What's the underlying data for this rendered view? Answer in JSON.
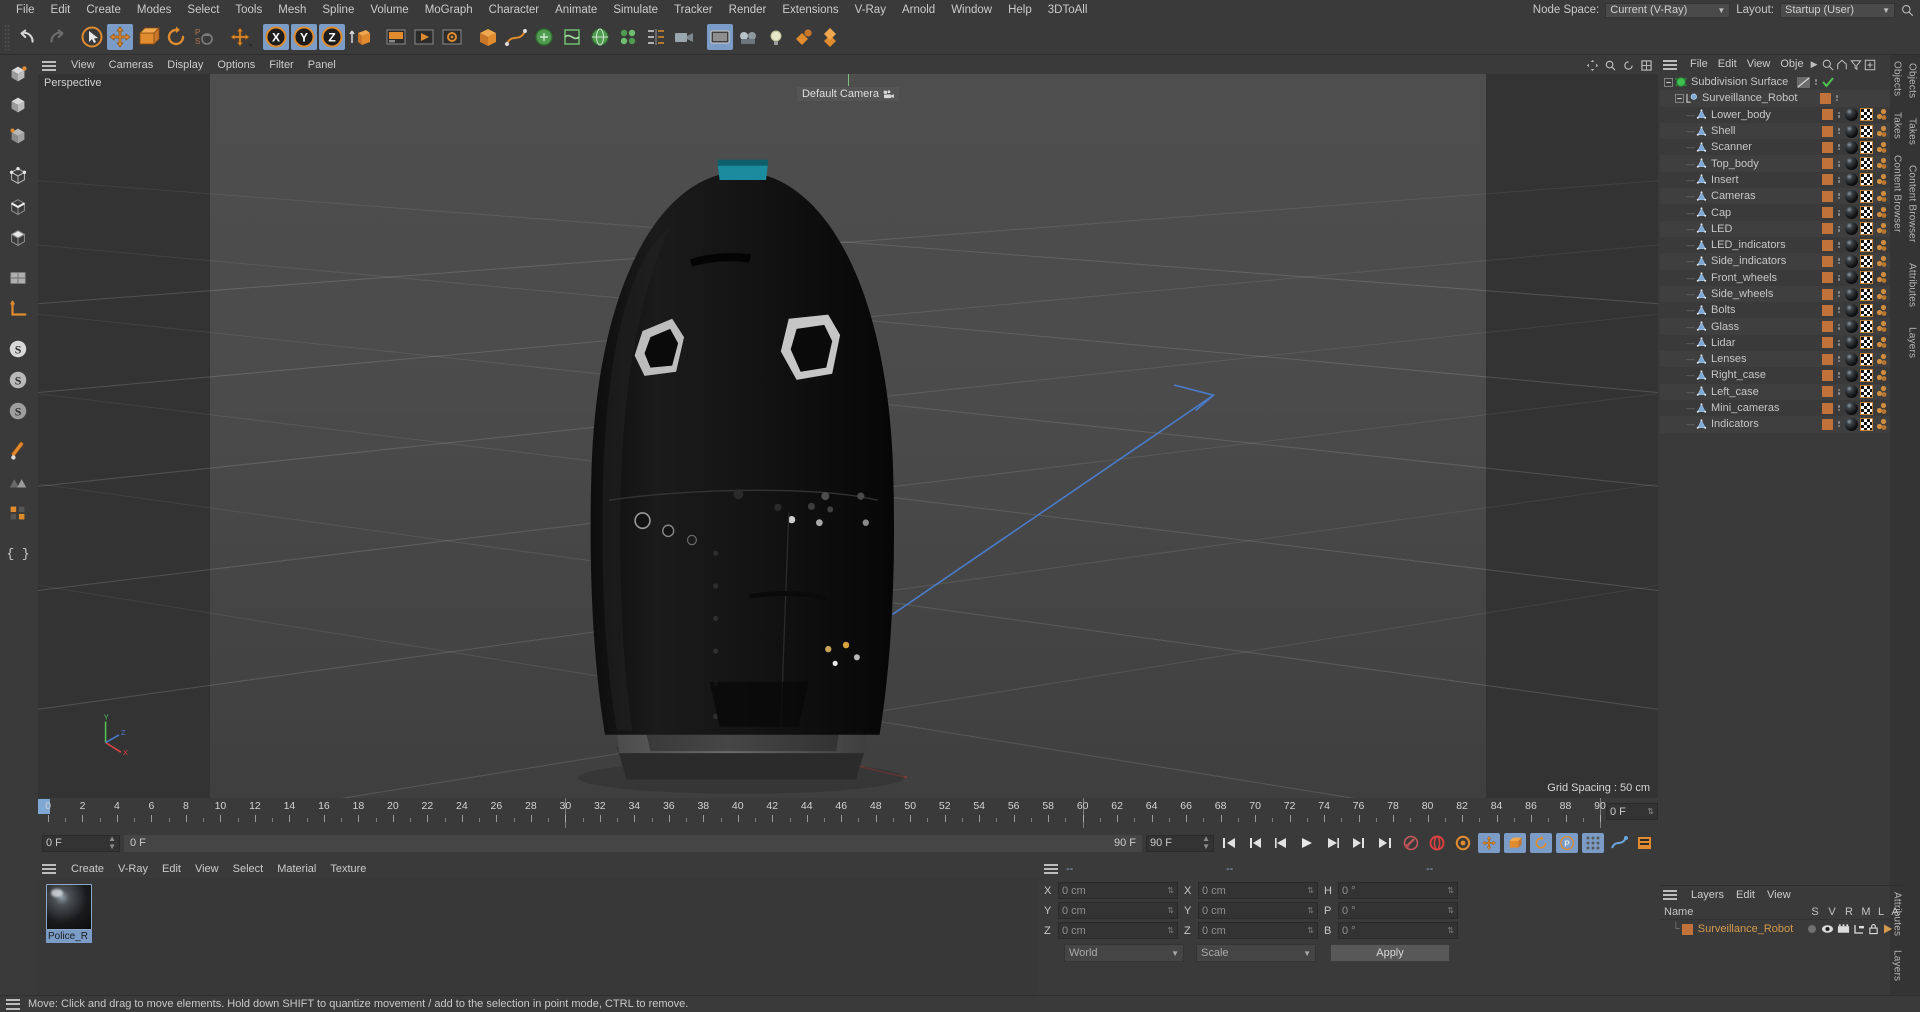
{
  "menubar": {
    "items": [
      "File",
      "Edit",
      "Create",
      "Modes",
      "Select",
      "Tools",
      "Mesh",
      "Spline",
      "Volume",
      "MoGraph",
      "Character",
      "Animate",
      "Simulate",
      "Tracker",
      "Render",
      "Extensions",
      "V-Ray",
      "Arnold",
      "Window",
      "Help",
      "3DToAll"
    ],
    "node_space_label": "Node Space:",
    "node_space_value": "Current (V-Ray)",
    "layout_label": "Layout:",
    "layout_value": "Startup (User)"
  },
  "toolbar": {
    "buttons": [
      {
        "name": "undo",
        "label": "Undo",
        "active": false
      },
      {
        "name": "redo",
        "label": "Redo",
        "active": false
      },
      {
        "name": "live-selection",
        "label": "Live Selection",
        "active": false
      },
      {
        "name": "move",
        "label": "Move",
        "active": true
      },
      {
        "name": "scale",
        "label": "Scale",
        "active": false
      },
      {
        "name": "rotate",
        "label": "Rotate",
        "active": false
      },
      {
        "name": "parametric-switch",
        "label": "Parametric",
        "active": false
      },
      {
        "name": "world-coordinate",
        "label": "World Coordinate System",
        "active": false
      },
      {
        "name": "x-axis-lock",
        "label": "X",
        "active": true
      },
      {
        "name": "y-axis-lock",
        "label": "Y",
        "active": true
      },
      {
        "name": "z-axis-lock",
        "label": "Z",
        "active": true
      },
      {
        "name": "world-object-axis",
        "label": "World/Object",
        "active": false
      },
      {
        "name": "render-view",
        "label": "Render View",
        "active": false
      },
      {
        "name": "render-to-picture-viewer",
        "label": "Render to Picture Viewer",
        "active": false
      },
      {
        "name": "render-settings",
        "label": "Render Settings",
        "active": false
      },
      {
        "name": "add-cube-object",
        "label": "Cube",
        "active": false
      },
      {
        "name": "add-spline",
        "label": "Spline",
        "active": false
      },
      {
        "name": "generators",
        "label": "Generators",
        "active": false
      },
      {
        "name": "bend-deformer",
        "label": "Deformers",
        "active": false
      },
      {
        "name": "environment",
        "label": "Environment",
        "active": false
      },
      {
        "name": "mograph",
        "label": "MoGraph",
        "active": false
      },
      {
        "name": "array-grid",
        "label": "Array",
        "active": false
      },
      {
        "name": "camera",
        "label": "Camera",
        "active": false
      },
      {
        "name": "display-shading",
        "label": "Display",
        "active": true
      },
      {
        "name": "scene-camera",
        "label": "Scene Camera",
        "active": false
      },
      {
        "name": "light",
        "label": "Light",
        "active": false
      },
      {
        "name": "materials",
        "label": "Materials",
        "active": false
      },
      {
        "name": "layers",
        "label": "Layers",
        "active": false
      }
    ]
  },
  "left_toolbar": {
    "buttons": [
      {
        "name": "make-editable",
        "label": "Make Editable"
      },
      {
        "name": "model-mode",
        "label": "Model Mode"
      },
      {
        "name": "texture-mode",
        "label": "Texture Mode"
      },
      {
        "name": "point-mode",
        "label": "Point Mode"
      },
      {
        "name": "edge-mode",
        "label": "Edge Mode"
      },
      {
        "name": "polygon-mode",
        "label": "Polygon Mode"
      },
      {
        "name": "workplane",
        "label": "Workplane"
      },
      {
        "name": "axis-lock",
        "label": "Enable Axis Modification"
      },
      {
        "name": "snap-enable",
        "label": "Enable Snapping"
      },
      {
        "name": "snap-quantize",
        "label": "Quantize"
      },
      {
        "name": "snap-workplane",
        "label": "Workplane Snap"
      },
      {
        "name": "viewport-solo",
        "label": "Viewport Solo Single"
      },
      {
        "name": "viewport-solo-hierarchy",
        "label": "Viewport Solo Hierarchy"
      },
      {
        "name": "viewport-solo-off",
        "label": "Viewport Solo Off"
      },
      {
        "name": "xpresso",
        "label": "XPresso"
      }
    ]
  },
  "viewport": {
    "menu": [
      "View",
      "Cameras",
      "Display",
      "Options",
      "Filter",
      "Panel"
    ],
    "perspective_label": "Perspective",
    "camera_label": "Default Camera",
    "grid_spacing": "Grid Spacing : 50 cm",
    "axis": {
      "x": "X",
      "y": "Y",
      "z": "Z"
    }
  },
  "timeline": {
    "ticks": [
      0,
      2,
      4,
      6,
      8,
      10,
      12,
      14,
      16,
      18,
      20,
      22,
      24,
      26,
      28,
      30,
      32,
      34,
      36,
      38,
      40,
      42,
      44,
      46,
      48,
      50,
      52,
      54,
      56,
      58,
      60,
      62,
      64,
      66,
      68,
      70,
      72,
      74,
      76,
      78,
      80,
      82,
      84,
      86,
      88,
      90
    ],
    "current_frame_field": "0 F",
    "bar_left_value": "0 F",
    "bar_right_value": "90 F",
    "end_frame_field": "90 F",
    "right_frame_field": "0 F",
    "transport": [
      {
        "name": "go-to-start",
        "label": "Go to Start"
      },
      {
        "name": "go-to-previous-key",
        "label": "Go to Previous Key"
      },
      {
        "name": "go-to-previous-frame",
        "label": "Go to Previous Frame"
      },
      {
        "name": "play",
        "label": "Play"
      },
      {
        "name": "go-to-next-frame",
        "label": "Go to Next Frame"
      },
      {
        "name": "go-to-next-key",
        "label": "Go to Next Key"
      },
      {
        "name": "go-to-end",
        "label": "Go to End"
      },
      {
        "name": "record-active-objects",
        "label": "Record Active Objects"
      },
      {
        "name": "autokeying",
        "label": "Autokeying"
      },
      {
        "name": "keyframe-selection",
        "label": "Keyframe Selection"
      },
      {
        "name": "position-key",
        "label": "Position",
        "active": true
      },
      {
        "name": "scale-key",
        "label": "Scale",
        "active": true
      },
      {
        "name": "rotation-key",
        "label": "Rotation",
        "active": true
      },
      {
        "name": "parameter-key",
        "label": "Parameter (PLA)",
        "active": true
      },
      {
        "name": "point-level-animation",
        "label": "Point Level Animation",
        "active": true
      },
      {
        "name": "animation-mode",
        "label": "Animation Mode"
      },
      {
        "name": "timeline-toggle",
        "label": "Timeline"
      }
    ]
  },
  "material_manager": {
    "menu": [
      "Create",
      "V-Ray",
      "Edit",
      "View",
      "Select",
      "Material",
      "Texture"
    ],
    "materials": [
      {
        "name": "Police_Robot",
        "display": "Police_R"
      }
    ]
  },
  "coordinates": {
    "header_dashes": [
      "--",
      "--",
      "--"
    ],
    "rows": [
      {
        "pos_label": "X",
        "pos_value": "0 cm",
        "size_label": "X",
        "size_value": "0 cm",
        "rot_label": "H",
        "rot_value": "0 °"
      },
      {
        "pos_label": "Y",
        "pos_value": "0 cm",
        "size_label": "Y",
        "size_value": "0 cm",
        "rot_label": "P",
        "rot_value": "0 °"
      },
      {
        "pos_label": "Z",
        "pos_value": "0 cm",
        "size_label": "Z",
        "size_value": "0 cm",
        "rot_label": "B",
        "rot_value": "0 °"
      }
    ],
    "system_select": "World",
    "mode_select": "Scale",
    "apply_label": "Apply"
  },
  "object_manager": {
    "menu": [
      "File",
      "Edit",
      "View",
      "Obje"
    ],
    "tabs": [
      "Objects",
      "Takes",
      "Content Browser"
    ],
    "items": [
      {
        "label": "Subdivision Surface",
        "depth": 0,
        "icon": "subdivision-surface-icon",
        "has_swatch": false,
        "has_tags": false,
        "check": true
      },
      {
        "label": "Surveillance_Robot",
        "depth": 1,
        "icon": "null-object-icon",
        "has_swatch": true,
        "has_tags": false
      },
      {
        "label": "Lower_body",
        "depth": 2,
        "icon": "polygon-object-icon",
        "has_swatch": true,
        "has_tags": true
      },
      {
        "label": "Shell",
        "depth": 2,
        "icon": "polygon-object-icon",
        "has_swatch": true,
        "has_tags": true
      },
      {
        "label": "Scanner",
        "depth": 2,
        "icon": "polygon-object-icon",
        "has_swatch": true,
        "has_tags": true
      },
      {
        "label": "Top_body",
        "depth": 2,
        "icon": "polygon-object-icon",
        "has_swatch": true,
        "has_tags": true
      },
      {
        "label": "Insert",
        "depth": 2,
        "icon": "polygon-object-icon",
        "has_swatch": true,
        "has_tags": true
      },
      {
        "label": "Cameras",
        "depth": 2,
        "icon": "polygon-object-icon",
        "has_swatch": true,
        "has_tags": true
      },
      {
        "label": "Cap",
        "depth": 2,
        "icon": "polygon-object-icon",
        "has_swatch": true,
        "has_tags": true
      },
      {
        "label": "LED",
        "depth": 2,
        "icon": "polygon-object-icon",
        "has_swatch": true,
        "has_tags": true
      },
      {
        "label": "LED_indicators",
        "depth": 2,
        "icon": "polygon-object-icon",
        "has_swatch": true,
        "has_tags": true
      },
      {
        "label": "Side_indicators",
        "depth": 2,
        "icon": "polygon-object-icon",
        "has_swatch": true,
        "has_tags": true
      },
      {
        "label": "Front_wheels",
        "depth": 2,
        "icon": "polygon-object-icon",
        "has_swatch": true,
        "has_tags": true
      },
      {
        "label": "Side_wheels",
        "depth": 2,
        "icon": "polygon-object-icon",
        "has_swatch": true,
        "has_tags": true
      },
      {
        "label": "Bolts",
        "depth": 2,
        "icon": "polygon-object-icon",
        "has_swatch": true,
        "has_tags": true
      },
      {
        "label": "Glass",
        "depth": 2,
        "icon": "polygon-object-icon",
        "has_swatch": true,
        "has_tags": true
      },
      {
        "label": "Lidar",
        "depth": 2,
        "icon": "polygon-object-icon",
        "has_swatch": true,
        "has_tags": true
      },
      {
        "label": "Lenses",
        "depth": 2,
        "icon": "polygon-object-icon",
        "has_swatch": true,
        "has_tags": true
      },
      {
        "label": "Right_case",
        "depth": 2,
        "icon": "polygon-object-icon",
        "has_swatch": true,
        "has_tags": true
      },
      {
        "label": "Left_case",
        "depth": 2,
        "icon": "polygon-object-icon",
        "has_swatch": true,
        "has_tags": true
      },
      {
        "label": "Mini_cameras",
        "depth": 2,
        "icon": "polygon-object-icon",
        "has_swatch": true,
        "has_tags": true
      },
      {
        "label": "Indicators",
        "depth": 2,
        "icon": "polygon-object-icon",
        "has_swatch": true,
        "has_tags": true
      }
    ]
  },
  "layers_panel": {
    "menu": [
      "Layers",
      "Edit",
      "View"
    ],
    "columns": [
      "Name",
      "S",
      "V",
      "R",
      "M",
      "L",
      "A"
    ],
    "rows": [
      {
        "name": "Surveillance_Robot",
        "color": "#c1713a"
      }
    ],
    "tabs": [
      "Attributes",
      "Layers"
    ]
  },
  "right_tabs": [
    "Objects",
    "Takes",
    "Content Browser"
  ],
  "far_right_tabs": [
    "Objects",
    "Takes",
    "Content Browser",
    "Attributes",
    "Layers"
  ],
  "statusbar": {
    "message": "Move: Click and drag to move elements. Hold down SHIFT to quantize movement / add to the selection in point mode, CTRL to remove."
  },
  "colors": {
    "accent_orange": "#e08b2e",
    "accent_blue": "#7a9cc6",
    "panel_bg": "#3a3a3a",
    "swatch_orange": "#c1713a",
    "teal": "#1a8c9e"
  }
}
